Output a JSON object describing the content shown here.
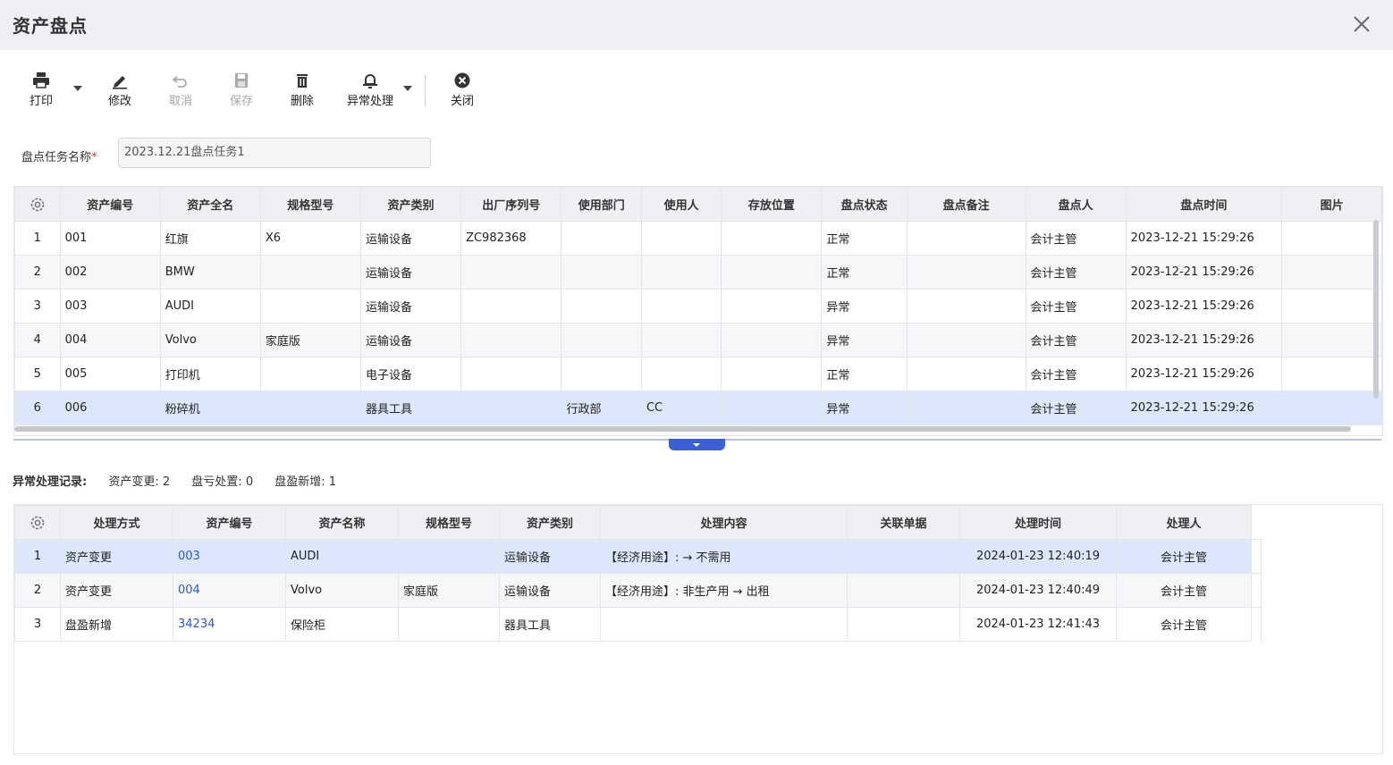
{
  "window": {
    "title": "资产盘点"
  },
  "toolbar": {
    "print": "打印",
    "edit": "修改",
    "cancel": "取消",
    "save": "保存",
    "delete": "删除",
    "exception": "异常处理",
    "close": "关闭"
  },
  "task": {
    "label": "盘点任务名称",
    "value": "2023.12.21盘点任务1"
  },
  "assets": {
    "columns": [
      "资产编号",
      "资产全名",
      "规格型号",
      "资产类别",
      "出厂序列号",
      "使用部门",
      "使用人",
      "存放位置",
      "盘点状态",
      "盘点备注",
      "盘点人",
      "盘点时间",
      "图片"
    ],
    "rows": [
      {
        "idx": "1",
        "code": "001",
        "name": "红旗",
        "spec": "X6",
        "category": "运输设备",
        "serial": "ZC982368",
        "dept": "",
        "user": "",
        "location": "",
        "status": "正常",
        "remark": "",
        "checker": "会计主管",
        "time": "2023-12-21 15:29:26",
        "image": ""
      },
      {
        "idx": "2",
        "code": "002",
        "name": "BMW",
        "spec": "",
        "category": "运输设备",
        "serial": "",
        "dept": "",
        "user": "",
        "location": "",
        "status": "正常",
        "remark": "",
        "checker": "会计主管",
        "time": "2023-12-21 15:29:26",
        "image": ""
      },
      {
        "idx": "3",
        "code": "003",
        "name": "AUDI",
        "spec": "",
        "category": "运输设备",
        "serial": "",
        "dept": "",
        "user": "",
        "location": "",
        "status": "异常",
        "remark": "",
        "checker": "会计主管",
        "time": "2023-12-21 15:29:26",
        "image": ""
      },
      {
        "idx": "4",
        "code": "004",
        "name": "Volvo",
        "spec": "家庭版",
        "category": "运输设备",
        "serial": "",
        "dept": "",
        "user": "",
        "location": "",
        "status": "异常",
        "remark": "",
        "checker": "会计主管",
        "time": "2023-12-21 15:29:26",
        "image": ""
      },
      {
        "idx": "5",
        "code": "005",
        "name": "打印机",
        "spec": "",
        "category": "电子设备",
        "serial": "",
        "dept": "",
        "user": "",
        "location": "",
        "status": "正常",
        "remark": "",
        "checker": "会计主管",
        "time": "2023-12-21 15:29:26",
        "image": ""
      },
      {
        "idx": "6",
        "code": "006",
        "name": "粉碎机",
        "spec": "",
        "category": "器具工具",
        "serial": "",
        "dept": "行政部",
        "user": "CC",
        "location": "",
        "status": "异常",
        "remark": "",
        "checker": "会计主管",
        "time": "2023-12-21 15:29:26",
        "image": ""
      }
    ]
  },
  "summary": {
    "label": "异常处理记录:",
    "change_label": "资产变更:",
    "change_count": "2",
    "loss_label": "盘亏处置:",
    "loss_count": "0",
    "gain_label": "盘盈新增:",
    "gain_count": "1"
  },
  "records": {
    "columns": [
      "处理方式",
      "资产编号",
      "资产名称",
      "规格型号",
      "资产类别",
      "处理内容",
      "关联单据",
      "处理时间",
      "处理人"
    ],
    "rows": [
      {
        "idx": "1",
        "method": "资产变更",
        "code": "003",
        "name": "AUDI",
        "spec": "",
        "category": "运输设备",
        "content": "【经济用途】: → 不需用",
        "doc": "",
        "time": "2024-01-23 12:40:19",
        "handler": "会计主管"
      },
      {
        "idx": "2",
        "method": "资产变更",
        "code": "004",
        "name": "Volvo",
        "spec": "家庭版",
        "category": "运输设备",
        "content": "【经济用途】: 非生产用 → 出租",
        "doc": "",
        "time": "2024-01-23 12:40:49",
        "handler": "会计主管"
      },
      {
        "idx": "3",
        "method": "盘盈新增",
        "code": "34234",
        "name": "保险柜",
        "spec": "",
        "category": "器具工具",
        "content": "",
        "doc": "",
        "time": "2024-01-23 12:41:43",
        "handler": "会计主管"
      }
    ]
  },
  "icons": {
    "close": "close-icon",
    "print": "printer-icon",
    "edit": "pencil-icon",
    "cancel": "undo-icon",
    "save": "floppy-icon",
    "delete": "trash-icon",
    "exception": "bell-icon",
    "close_circle": "close-circle-icon",
    "settings": "gear-icon"
  },
  "colors": {
    "accent": "#3b5fd6",
    "selected_row": "#dde7fb",
    "link": "#2b57d8",
    "required": "#ee2233"
  }
}
